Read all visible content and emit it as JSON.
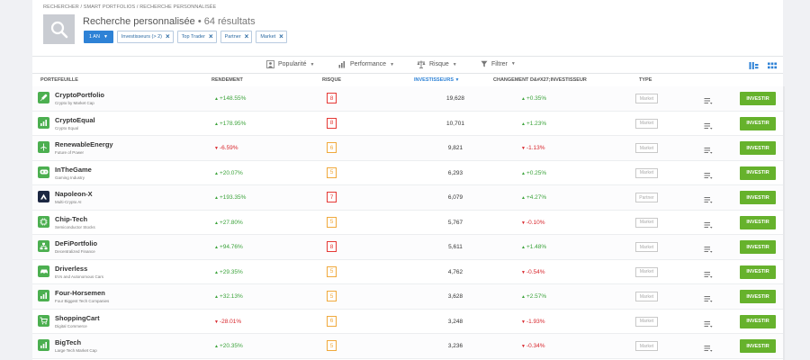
{
  "breadcrumb": [
    "Rechercher",
    "Smart Portfolios",
    "Recherche personnalisée"
  ],
  "breadcrumb_separator": "/",
  "header": {
    "title": "Recherche personnalisée",
    "result_count": "• 64 résultats"
  },
  "filters": {
    "period": "1 AN",
    "chips": [
      "Investisseurs (> 2)",
      "Top Trader",
      "Partner",
      "Market"
    ]
  },
  "toolbar": {
    "items": [
      "Popularité",
      "Performance",
      "Risque",
      "Filtrer"
    ]
  },
  "columns": {
    "portfolio": "Portefeuille",
    "return": "Rendement",
    "risk": "Risque",
    "investors": "Investisseurs",
    "change": "Changement D&#x27;investisseur",
    "type": "Type"
  },
  "invest_label": "INVESTIR",
  "colors": {
    "accent": "#2e82d6",
    "invest": "#66b22c",
    "positive": "#3ca33b",
    "negative": "#d8262c"
  },
  "rows": [
    {
      "name": "CryptoPortfolio",
      "sub": "Crypto by Market Cap",
      "ret": "+148.55%",
      "ret_dir": "pos",
      "risk": "8",
      "risk_level": "high",
      "investors": "19,628",
      "change": "+0.35%",
      "change_dir": "pos",
      "type": "Market",
      "icon": "rocket-icon"
    },
    {
      "name": "CryptoEqual",
      "sub": "Crypto Equal",
      "ret": "+178.95%",
      "ret_dir": "pos",
      "risk": "8",
      "risk_level": "high",
      "investors": "10,701",
      "change": "+1.23%",
      "change_dir": "pos",
      "type": "Market",
      "icon": "chart-bars-icon"
    },
    {
      "name": "RenewableEnergy",
      "sub": "Future of Power",
      "ret": "-6.59%",
      "ret_dir": "neg",
      "risk": "6",
      "risk_level": "med",
      "investors": "9,821",
      "change": "-1.13%",
      "change_dir": "neg",
      "type": "Market",
      "icon": "wind-turbine-icon"
    },
    {
      "name": "InTheGame",
      "sub": "Gaming Industry",
      "ret": "+20.07%",
      "ret_dir": "pos",
      "risk": "5",
      "risk_level": "med",
      "investors": "6,293",
      "change": "+0.25%",
      "change_dir": "pos",
      "type": "Market",
      "icon": "gamepad-icon"
    },
    {
      "name": "Napoleon-X",
      "sub": "Multi-Crypto AI",
      "ret": "+193.35%",
      "ret_dir": "pos",
      "risk": "7",
      "risk_level": "high",
      "investors": "6,079",
      "change": "+4.27%",
      "change_dir": "pos",
      "type": "Partner",
      "icon": "napoleon-logo-icon"
    },
    {
      "name": "Chip-Tech",
      "sub": "Semiconductor Stocks",
      "ret": "+27.80%",
      "ret_dir": "pos",
      "risk": "5",
      "risk_level": "med",
      "investors": "5,767",
      "change": "-0.10%",
      "change_dir": "neg",
      "type": "Market",
      "icon": "chip-icon"
    },
    {
      "name": "DeFiPortfolio",
      "sub": "Decentralized Finance",
      "ret": "+94.76%",
      "ret_dir": "pos",
      "risk": "8",
      "risk_level": "high",
      "investors": "5,611",
      "change": "+1.48%",
      "change_dir": "pos",
      "type": "Market",
      "icon": "network-icon"
    },
    {
      "name": "Driverless",
      "sub": "EVs and Autonomous Cars",
      "ret": "+29.35%",
      "ret_dir": "pos",
      "risk": "5",
      "risk_level": "med",
      "investors": "4,762",
      "change": "-0.54%",
      "change_dir": "neg",
      "type": "Market",
      "icon": "car-icon"
    },
    {
      "name": "Four-Horsemen",
      "sub": "Four Biggest Tech Companies",
      "ret": "+32.13%",
      "ret_dir": "pos",
      "risk": "5",
      "risk_level": "med",
      "investors": "3,628",
      "change": "+2.57%",
      "change_dir": "pos",
      "type": "Market",
      "icon": "chart-bars-icon"
    },
    {
      "name": "ShoppingCart",
      "sub": "Digital Commerce",
      "ret": "-28.01%",
      "ret_dir": "neg",
      "risk": "6",
      "risk_level": "med",
      "investors": "3,248",
      "change": "-1.93%",
      "change_dir": "neg",
      "type": "Market",
      "icon": "cart-icon"
    },
    {
      "name": "BigTech",
      "sub": "Large Tech Market Cap",
      "ret": "+20.35%",
      "ret_dir": "pos",
      "risk": "5",
      "risk_level": "med",
      "investors": "3,236",
      "change": "-0.34%",
      "change_dir": "neg",
      "type": "Market",
      "icon": "chart-bars-icon"
    }
  ]
}
